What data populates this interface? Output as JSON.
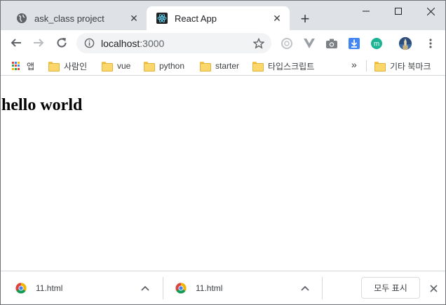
{
  "tabs": [
    {
      "title": "ask_class project",
      "favicon": "globe-icon"
    },
    {
      "title": "React App",
      "favicon": "react-icon"
    }
  ],
  "address_bar": {
    "host": "localhost",
    "port": ":3000"
  },
  "bookmarks": [
    {
      "label": "앱",
      "icon": "apps-grid-icon"
    },
    {
      "label": "사람인",
      "icon": "folder-icon"
    },
    {
      "label": "vue",
      "icon": "folder-icon"
    },
    {
      "label": "python",
      "icon": "folder-icon"
    },
    {
      "label": "starter",
      "icon": "folder-icon"
    },
    {
      "label": "타입스크립트",
      "icon": "folder-icon"
    },
    {
      "label": "기타 북마크",
      "icon": "folder-icon"
    }
  ],
  "bookmarks_overflow": "»",
  "page": {
    "heading": "hello world"
  },
  "downloads": [
    {
      "filename": "11.html"
    },
    {
      "filename": "11.html"
    }
  ],
  "download_shelf": {
    "show_all_label": "모두 표시"
  },
  "colors": {
    "tab_strip": "#dee1e6",
    "omnibox": "#f1f3f4",
    "download_arrow": "#4285f4",
    "ext_m": "#1ab394"
  }
}
